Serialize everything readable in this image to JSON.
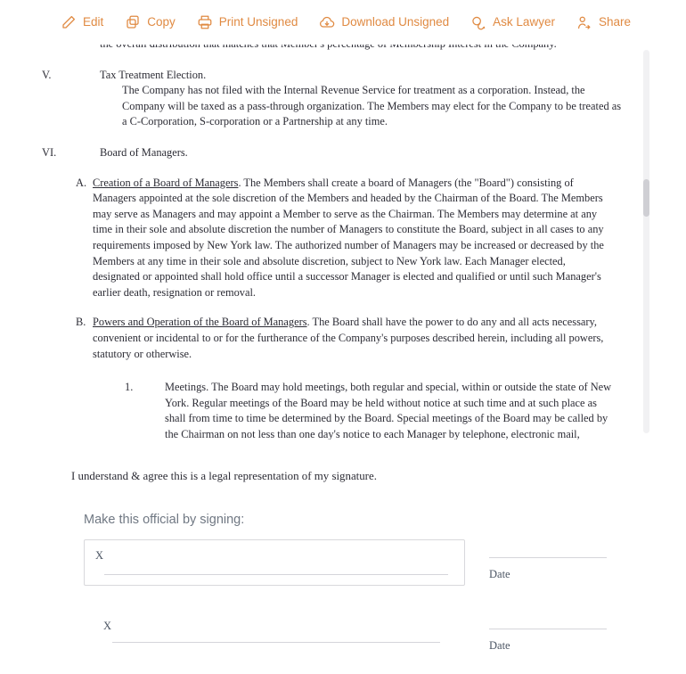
{
  "theme": {
    "accent": "#e08a42",
    "doc_text": "#2c2c35",
    "muted": "#707883"
  },
  "toolbar": {
    "items": [
      {
        "label": "Edit",
        "icon": "pencil-icon"
      },
      {
        "label": "Copy",
        "icon": "copy-icon"
      },
      {
        "label": "Print Unsigned",
        "icon": "printer-icon"
      },
      {
        "label": "Download Unsigned",
        "icon": "cloud-download-icon"
      },
      {
        "label": "Ask Lawyer",
        "icon": "chat-bubble-icon"
      },
      {
        "label": "Share",
        "icon": "person-share-icon"
      }
    ]
  },
  "document": {
    "clipped_top_line": "the overall distribution that matches that Member's percentage of Membership Interest in the Company.",
    "sections": [
      {
        "numeral": "V.",
        "title": "Tax Treatment Election.",
        "paragraph": "The Company has not filed with the Internal Revenue Service for treatment as a corporation. Instead, the Company will be taxed as a pass-through organization. The Members may elect for the Company to be treated as a C-Corporation, S-corporation or a Partnership at any time."
      },
      {
        "numeral": "VI.",
        "title": "Board of Managers.",
        "subsections": [
          {
            "letter": "A.",
            "heading": "Creation of a Board of Managers",
            "body": ". The Members shall create a board of Managers (the \"Board\") consisting of Managers appointed at the sole discretion of the Members and headed by the Chairman of the Board. The Members may serve as Managers and may appoint a Member to serve as the Chairman. The Members may determine at any time in their sole and absolute discretion the number of Managers to constitute the Board, subject in all cases to any requirements imposed by New York law. The authorized number of Managers may be increased or decreased by the Members at any time in their sole and absolute discretion, subject to New York law. Each Manager elected, designated or appointed shall hold office until a successor Manager is elected and qualified or until such Manager's earlier death, resignation or removal."
          },
          {
            "letter": "B.",
            "heading": "Powers and Operation of the Board of Managers",
            "body": ". The Board shall have the power to do any and all acts necessary, convenient or incidental to or for the furtherance of the Company's purposes described herein, including all powers, statutory or otherwise.",
            "items": [
              {
                "number": "1.",
                "text": "Meetings. The Board may hold meetings, both regular and special, within or outside the state of New York. Regular meetings of the Board may be held without notice at such time and at such place as shall from time to time be determined by the Board. Special meetings of the Board may be called by the Chairman on not less than one day's notice to each Manager by telephone, electronic mail, facsimile, mail or as otherwise agreed or permitted."
              }
            ]
          }
        ]
      }
    ]
  },
  "agreement": {
    "statement": "I understand & agree this is a legal representation of my signature."
  },
  "signing": {
    "heading": "Make this official by signing:",
    "rows": [
      {
        "x_marker": "X",
        "date_label": "Date",
        "boxed": true
      },
      {
        "x_marker": "X",
        "date_label": "Date",
        "boxed": false
      }
    ]
  }
}
